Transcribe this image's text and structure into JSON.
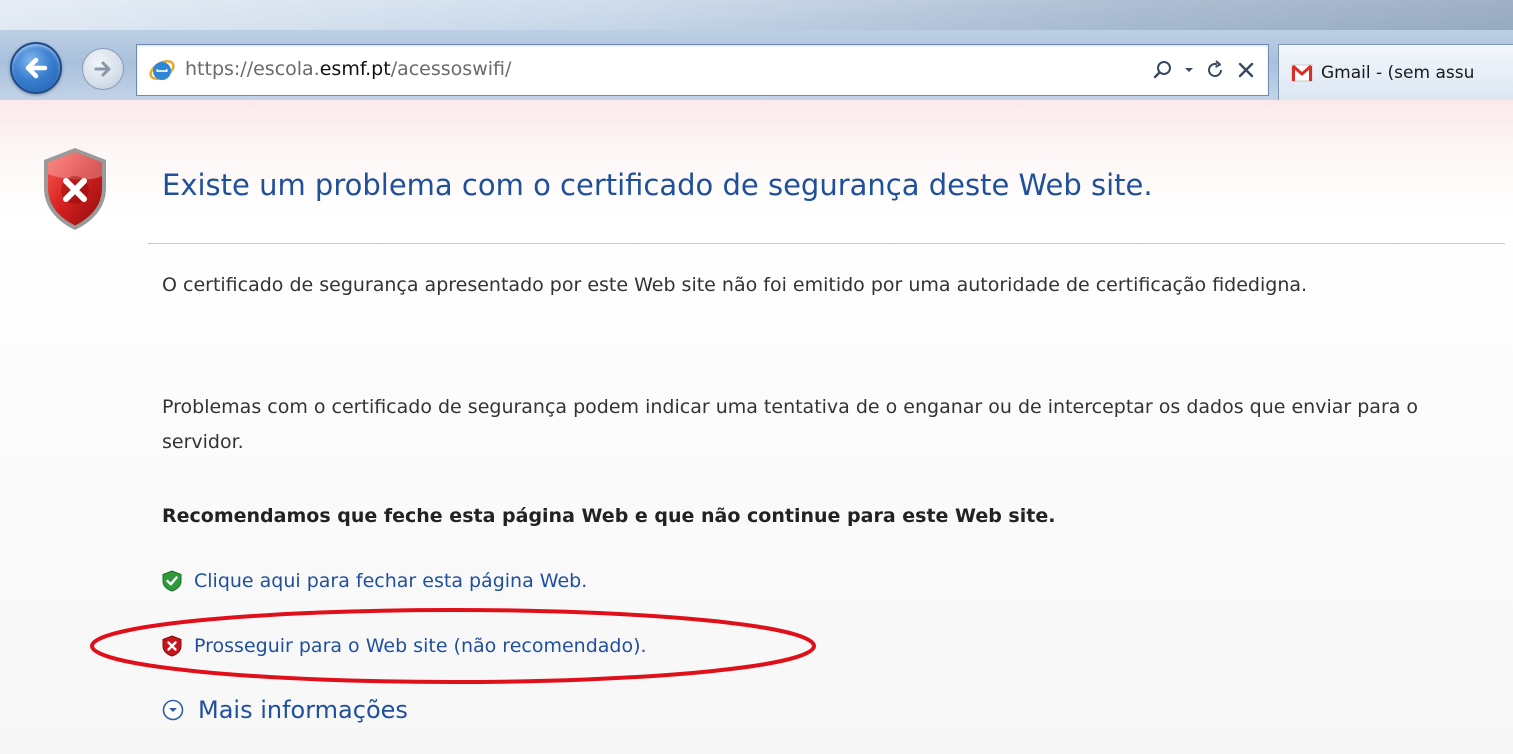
{
  "browser": {
    "address": {
      "url_prefix": "https://escola.",
      "url_host": "esmf.pt",
      "url_path": "/acessoswifi/"
    },
    "tab": {
      "label": "Gmail - (sem assu"
    }
  },
  "page": {
    "heading": "Existe um problema com o certificado de segurança deste Web site.",
    "paragraph1": "O certificado de segurança apresentado por este Web site não foi emitido por uma autoridade de certificação fidedigna.",
    "paragraph2": "Problemas com o certificado de segurança podem indicar uma tentativa de o enganar ou de interceptar os dados que enviar para o servidor.",
    "recommendation": "Recomendamos que feche esta página Web e que não continue para este Web site.",
    "close_link": "Clique aqui para fechar esta página Web.",
    "proceed_link": "Prosseguir para o Web site (não recomendado).",
    "more_info": "Mais informações"
  },
  "colors": {
    "heading": "#21509a",
    "link": "#1f4f9e",
    "annotation_ellipse": "#e0101a",
    "shield_red": "#c8151b",
    "shield_green": "#2e9a3c"
  },
  "icons": {
    "back": "arrow-left-icon",
    "forward": "arrow-right-icon",
    "site": "ie-logo-icon",
    "search": "search-icon",
    "refresh": "refresh-icon",
    "stop": "close-icon",
    "tab": "gmail-icon",
    "error": "error-shield-icon",
    "safe": "green-check-shield-icon",
    "unsafe": "red-x-shield-icon",
    "expand": "chevron-down-circle-icon"
  }
}
